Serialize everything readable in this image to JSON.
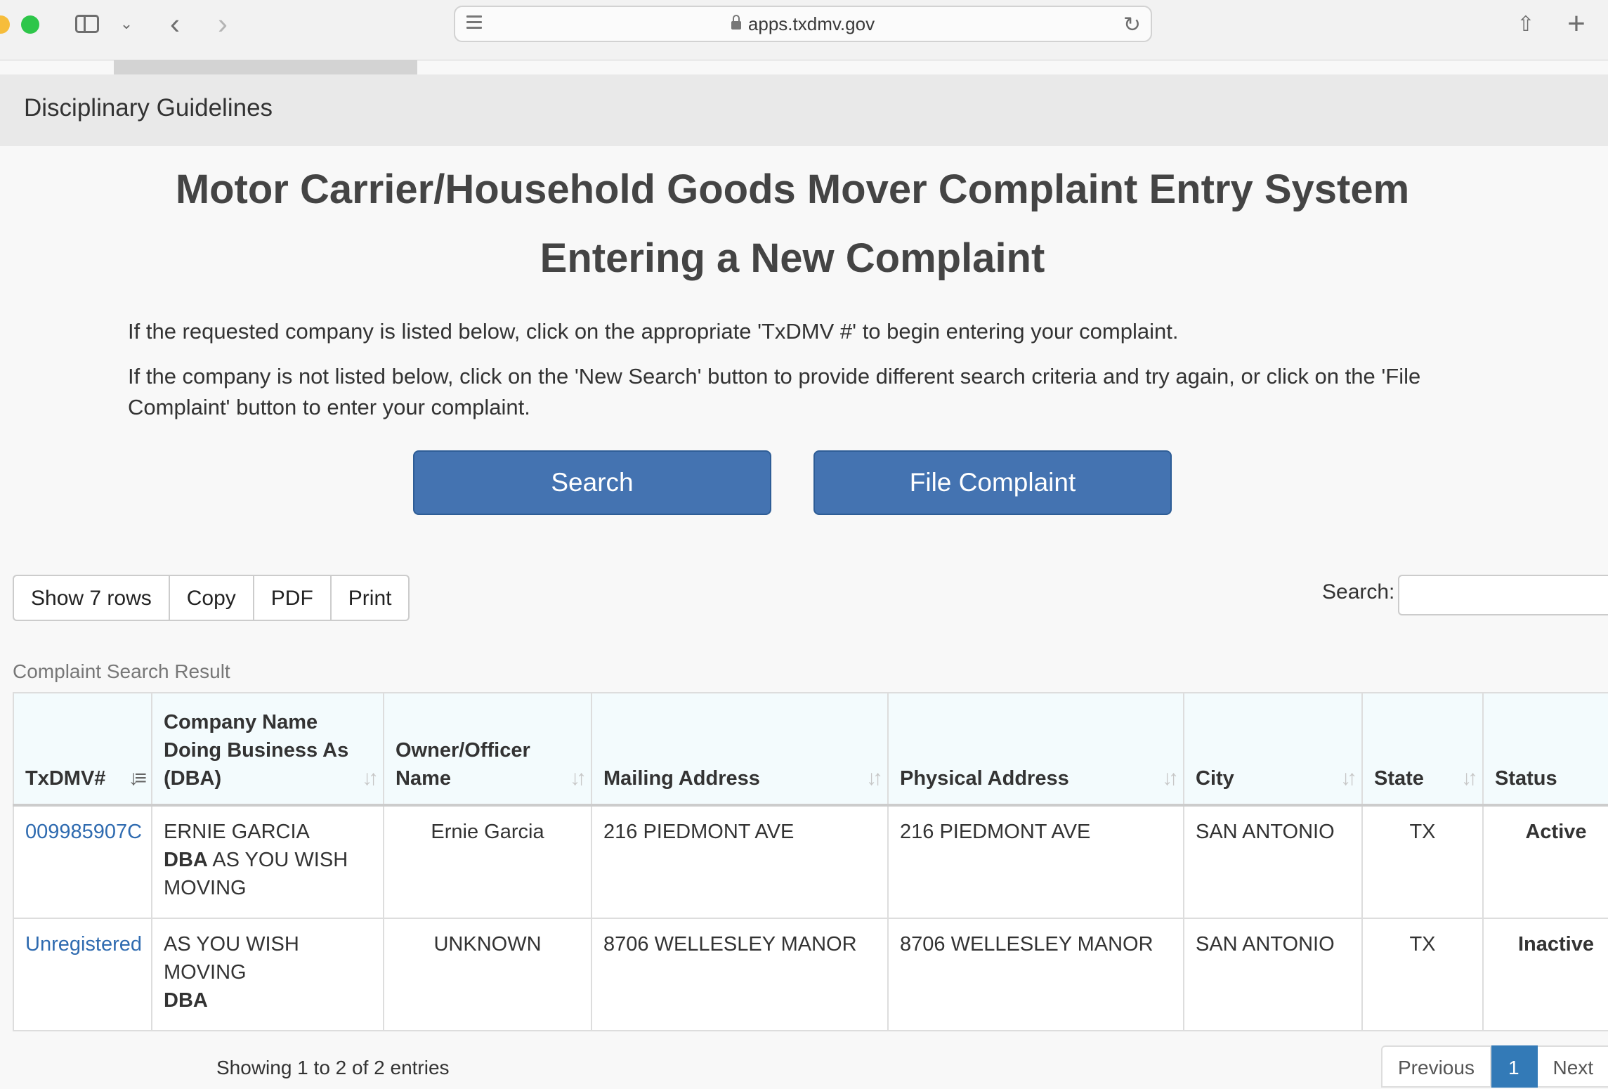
{
  "browser": {
    "url": "apps.txdmv.gov"
  },
  "nav": {
    "breadcrumb": "Disciplinary Guidelines"
  },
  "page": {
    "title": "Motor Carrier/Household Goods Mover Complaint Entry System",
    "subtitle": "Entering a New Complaint",
    "instruction_1": "If the requested company is listed below, click on the appropriate 'TxDMV #' to begin entering your complaint.",
    "instruction_2": "If the company is not listed below, click on the 'New Search' button to provide different search criteria and try again, or click on the 'File Complaint' button to enter your complaint.",
    "search_button": "Search",
    "file_complaint_button": "File Complaint"
  },
  "table_tools": {
    "buttons": [
      "Show 7 rows",
      "Copy",
      "PDF",
      "Print"
    ],
    "search_label": "Search:",
    "search_value": ""
  },
  "table": {
    "caption": "Complaint Search Result",
    "headers": [
      "TxDMV#",
      "Company Name Doing Business As (DBA)",
      "Owner/Officer Name",
      "Mailing Address",
      "Physical Address",
      "City",
      "State",
      "Status"
    ],
    "rows": [
      {
        "txdmv": "009985907C",
        "company": "ERNIE GARCIA",
        "dba_label": "DBA",
        "dba": "AS YOU WISH MOVING",
        "owner": "Ernie Garcia",
        "mailing": "216 PIEDMONT AVE",
        "physical": "216 PIEDMONT AVE",
        "city": "SAN ANTONIO",
        "state": "TX",
        "status": "Active"
      },
      {
        "txdmv": "Unregistered",
        "company": "AS YOU WISH MOVING",
        "dba_label": "DBA",
        "dba": "",
        "owner": "UNKNOWN",
        "mailing": "8706 WELLESLEY MANOR",
        "physical": "8706 WELLESLEY MANOR",
        "city": "SAN ANTONIO",
        "state": "TX",
        "status": "Inactive"
      }
    ]
  },
  "footer": {
    "info": "Showing 1 to 2 of 2 entries",
    "pager": [
      "Previous",
      "1",
      "Next"
    ]
  }
}
